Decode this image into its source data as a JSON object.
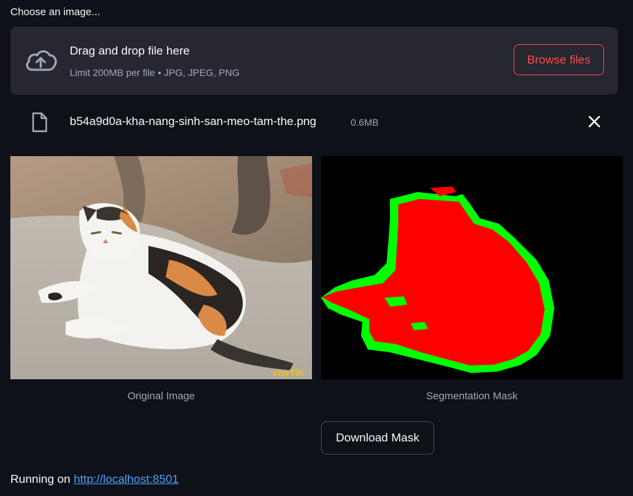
{
  "uploader": {
    "label": "Choose an image...",
    "title": "Drag and drop file here",
    "limit": "Limit 200MB per file • JPG, JPEG, PNG",
    "browse_label": "Browse files"
  },
  "file": {
    "name": "b54a9d0a-kha-nang-sinh-san-meo-tam-the.png",
    "size": "0.6MB"
  },
  "images": {
    "original_caption": "Original Image",
    "mask_caption": "Segmentation Mask",
    "watermark": "chợTốt"
  },
  "actions": {
    "download_label": "Download Mask"
  },
  "footer": {
    "prefix": "Running on ",
    "link": "http://localhost:8501"
  },
  "colors": {
    "background": "#0e1117",
    "accent": "#ff4b4b",
    "mask_fill": "#ff0000",
    "mask_edge": "#00ff00"
  }
}
